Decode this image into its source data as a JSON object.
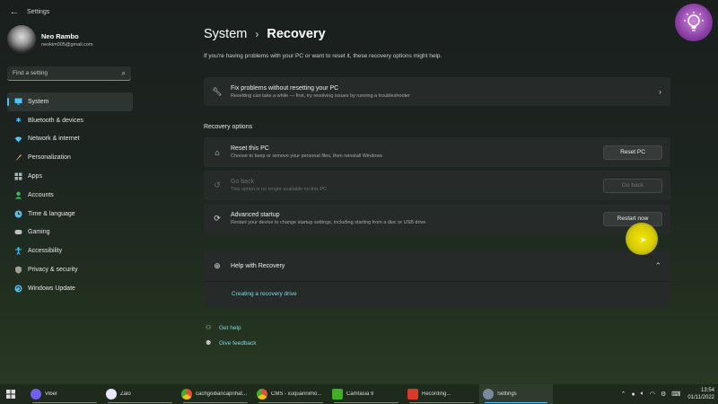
{
  "window": {
    "title": "Settings",
    "back_icon": "back-arrow-icon"
  },
  "user": {
    "name": "Neo Rambo",
    "email": "neokim005@gmail.com"
  },
  "search": {
    "placeholder": "Find a setting",
    "icon": "search-icon"
  },
  "sidebar": {
    "items": [
      {
        "label": "System",
        "icon": "monitor-icon",
        "color": "#4cc2ff",
        "active": true
      },
      {
        "label": "Bluetooth & devices",
        "icon": "bluetooth-icon",
        "color": "#4cc2ff"
      },
      {
        "label": "Network & internet",
        "icon": "wifi-icon",
        "color": "#4cc2ff"
      },
      {
        "label": "Personalization",
        "icon": "brush-icon",
        "color": "#f0a04b"
      },
      {
        "label": "Apps",
        "icon": "apps-icon",
        "color": "#a0b4c8"
      },
      {
        "label": "Accounts",
        "icon": "person-icon",
        "color": "#3fb950"
      },
      {
        "label": "Time & language",
        "icon": "globe-clock-icon",
        "color": "#4cc2ff"
      },
      {
        "label": "Gaming",
        "icon": "gamepad-icon",
        "color": "#c0c0c0"
      },
      {
        "label": "Accessibility",
        "icon": "accessibility-icon",
        "color": "#4cc2ff"
      },
      {
        "label": "Privacy & security",
        "icon": "shield-icon",
        "color": "#a0a0a0"
      },
      {
        "label": "Windows Update",
        "icon": "update-icon",
        "color": "#4cc2ff"
      }
    ]
  },
  "page": {
    "breadcrumb_parent": "System",
    "breadcrumb_current": "Recovery",
    "intro": "If you're having problems with your PC or want to reset it, these recovery options might help."
  },
  "fix_card": {
    "title": "Fix problems without resetting your PC",
    "desc": "Resetting can take a while — first, try resolving issues by running a troubleshooter"
  },
  "recovery": {
    "section_label": "Recovery options",
    "options": [
      {
        "title": "Reset this PC",
        "desc": "Choose to keep or remove your personal files, then reinstall Windows",
        "button": "Reset PC",
        "icon": "reset-pc-icon",
        "disabled": false
      },
      {
        "title": "Go back",
        "desc": "This option is no longer available on this PC",
        "button": "Go back",
        "icon": "history-icon",
        "disabled": true
      },
      {
        "title": "Advanced startup",
        "desc": "Restart your device to change startup settings, including starting from a disc or USB drive",
        "button": "Restart now",
        "icon": "advanced-startup-icon",
        "disabled": false
      }
    ]
  },
  "help": {
    "title": "Help with Recovery",
    "link": "Creating a recovery drive"
  },
  "footer_links": {
    "get_help": "Get help",
    "give_feedback": "Give feedback"
  },
  "taskbar": {
    "items": [
      {
        "label": "Viber",
        "color": "#7360f2"
      },
      {
        "label": "Zalo",
        "color": "#e8e8ff"
      },
      {
        "label": "cachgoibancapnhat...",
        "color": "#e0a030"
      },
      {
        "label": "CMS - xuquannimo...",
        "color": "#e04b3b"
      },
      {
        "label": "Camtasia 9",
        "color": "#3fae29"
      },
      {
        "label": "Recording...",
        "color": "#d9392b"
      },
      {
        "label": "Settings",
        "color": "#7a8aa0",
        "active": true
      }
    ],
    "time": "13:54",
    "date": "01/11/2022"
  }
}
